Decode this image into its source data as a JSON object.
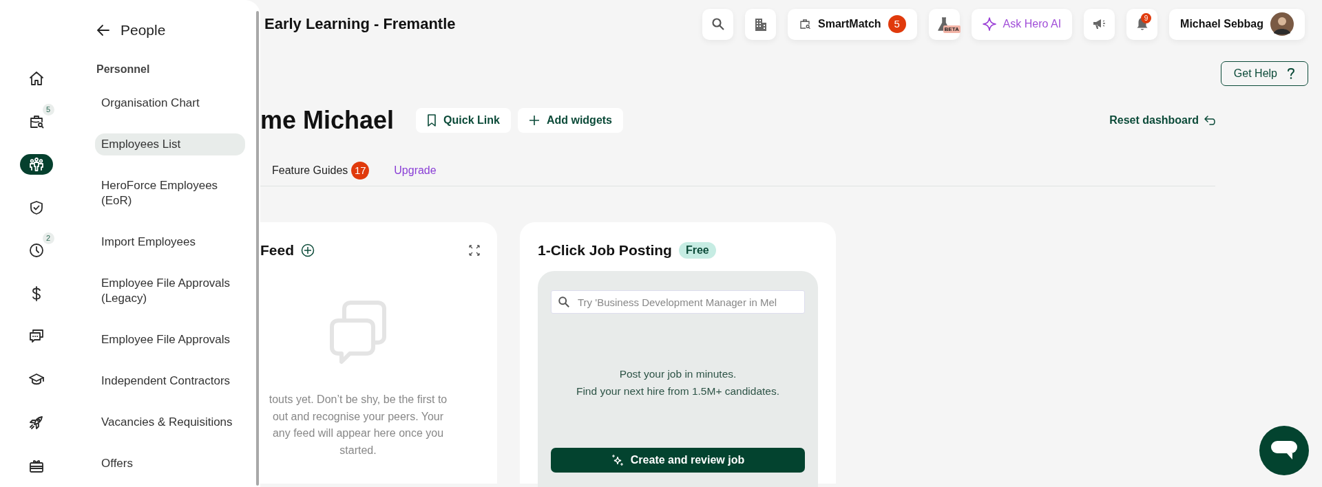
{
  "rail": {
    "items": [
      {
        "kind": "home",
        "selected": false
      },
      {
        "kind": "briefcase",
        "selected": false,
        "badge": "5"
      },
      {
        "kind": "people",
        "selected": true
      },
      {
        "kind": "shield",
        "selected": false
      },
      {
        "kind": "clock",
        "selected": false,
        "badge": "2"
      },
      {
        "kind": "dollar",
        "selected": false
      },
      {
        "kind": "chat",
        "selected": false
      },
      {
        "kind": "cap",
        "selected": false
      },
      {
        "kind": "rocket",
        "selected": false
      },
      {
        "kind": "gift",
        "selected": false
      }
    ]
  },
  "flyout": {
    "title": "People",
    "section": "Personnel",
    "items": [
      {
        "label": "Organisation Chart",
        "selected": false
      },
      {
        "label": "Employees List",
        "selected": true
      },
      {
        "label": "HeroForce Employees (EoR)",
        "selected": false
      },
      {
        "label": "Import Employees",
        "selected": false
      },
      {
        "label": "Employee File Approvals (Legacy)",
        "selected": false
      },
      {
        "label": "Employee File Approvals",
        "selected": false
      },
      {
        "label": "Independent Contractors",
        "selected": false
      },
      {
        "label": "Vacancies & Requisitions",
        "selected": false
      },
      {
        "label": "Offers",
        "selected": false
      }
    ]
  },
  "header": {
    "title": "Early Learning - Fremantle",
    "actions": [
      {
        "kind": "search"
      },
      {
        "kind": "building"
      },
      {
        "kind": "smartmatch",
        "label": "SmartMatch",
        "badge": "5"
      },
      {
        "kind": "beta",
        "label": "BETA"
      },
      {
        "kind": "ai",
        "label": "Ask Hero AI"
      },
      {
        "kind": "megaphone"
      },
      {
        "kind": "bell",
        "badge": "9"
      },
      {
        "kind": "user",
        "label": "Michael Sebbag"
      }
    ]
  },
  "help_button": "Get Help",
  "greeting": "me Michael",
  "toolbar": [
    {
      "kind": "bookmark",
      "label": "Quick Link"
    },
    {
      "kind": "plus",
      "label": "Add widgets"
    }
  ],
  "reset": "Reset dashboard",
  "tabs": [
    {
      "label": "Feature Guides",
      "badge": "17",
      "kind": "plain"
    },
    {
      "label": "Upgrade",
      "kind": "upgrade"
    }
  ],
  "feed_card": {
    "title": "Feed",
    "message_lines": [
      "touts yet. Don’t be shy, be the first to",
      "out and recognise your peers. Your",
      "any feed will appear here once you",
      "started."
    ]
  },
  "job_card": {
    "title": "1-Click Job Posting",
    "badge": "Free",
    "search": {
      "placeholder": "Try 'Business Development Manager in Mel"
    },
    "lines": [
      "Post your job in minutes.",
      "Find your next hire from 1.5M+ candidates."
    ],
    "button": "Create and review job"
  }
}
